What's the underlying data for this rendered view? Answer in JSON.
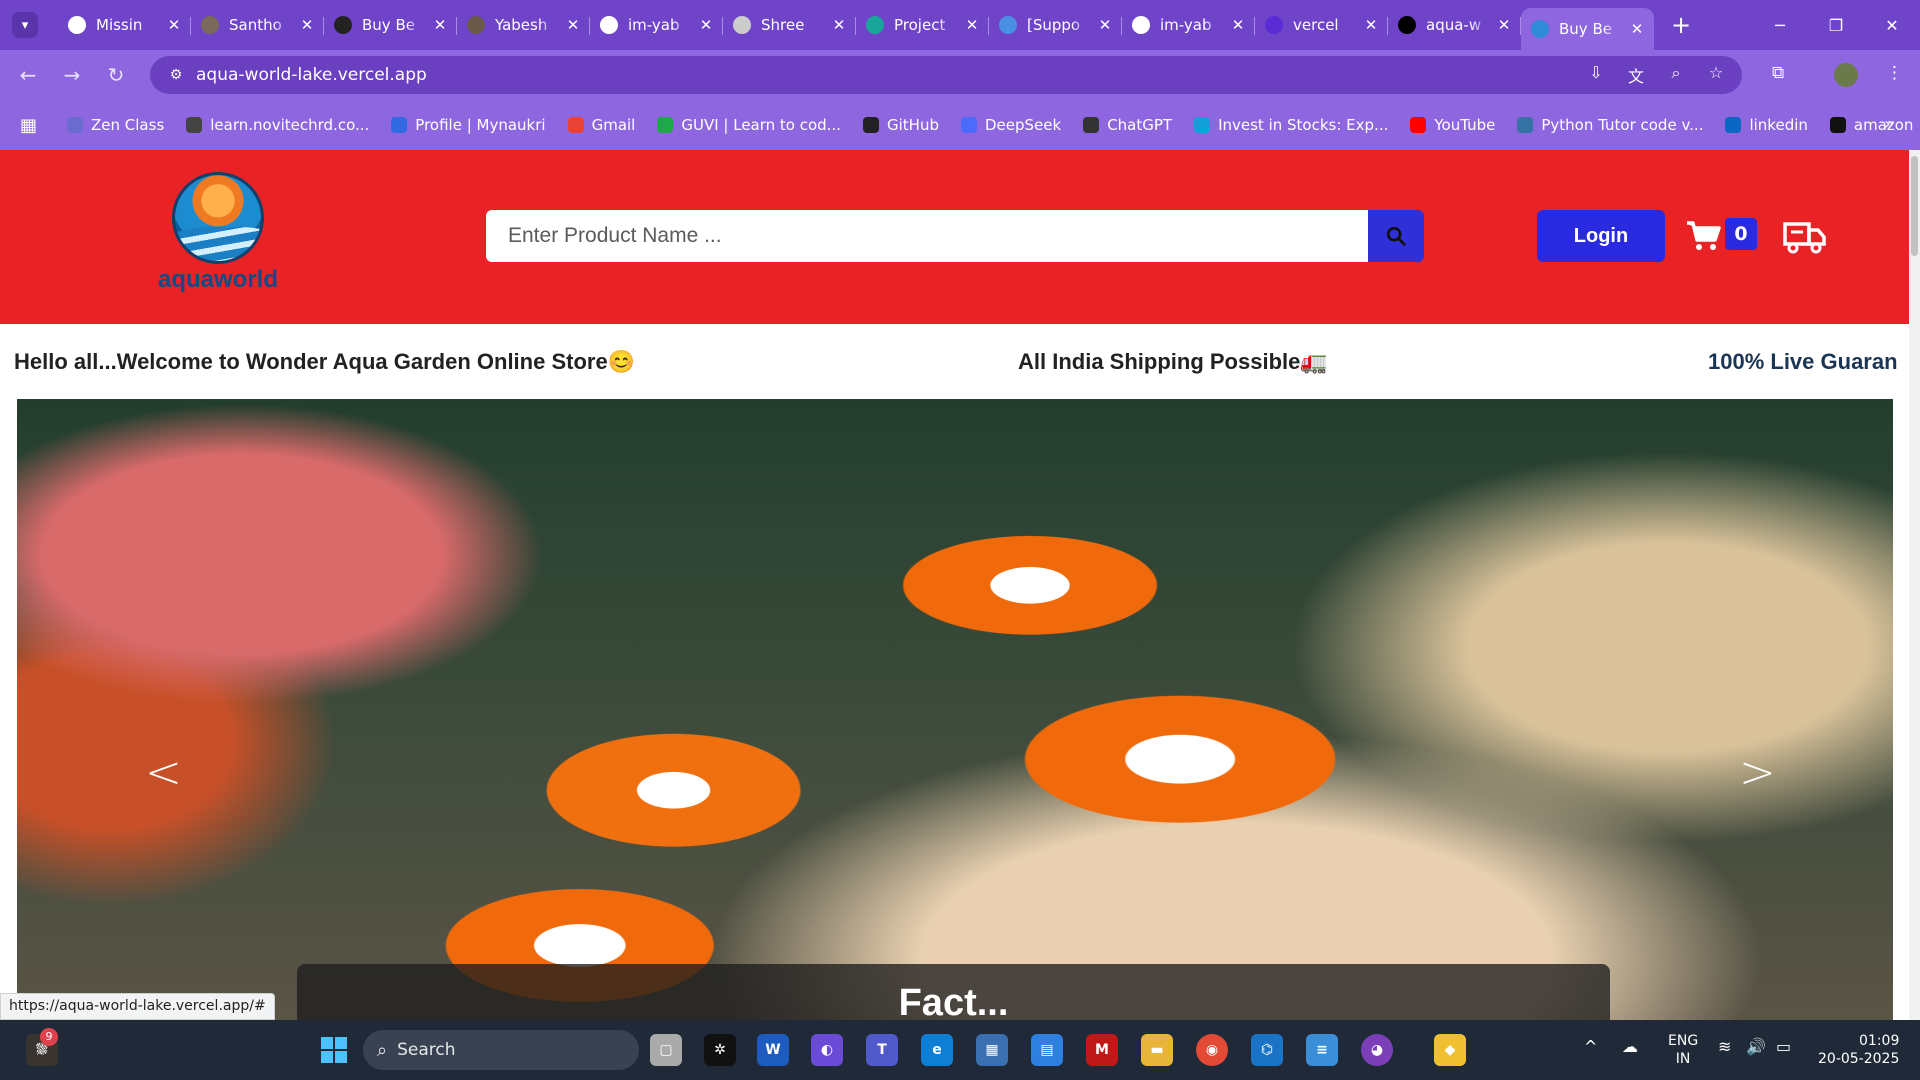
{
  "browser": {
    "tabs": [
      {
        "title": "Missin",
        "favicon_color": "#ffffff"
      },
      {
        "title": "Santho",
        "favicon_color": "#7a6a5a"
      },
      {
        "title": "Buy Be",
        "favicon_color": "#222222"
      },
      {
        "title": "Yabesh",
        "favicon_color": "#6a5a4a"
      },
      {
        "title": "im-yab",
        "favicon_color": "#ffffff"
      },
      {
        "title": "Shree",
        "favicon_color": "#cccccc"
      },
      {
        "title": "Project",
        "favicon_color": "#19a59a"
      },
      {
        "title": "[Suppo",
        "favicon_color": "#4a90e2"
      },
      {
        "title": "im-yab",
        "favicon_color": "#ffffff"
      },
      {
        "title": "vercel",
        "favicon_color": "#5b2bd6"
      },
      {
        "title": "aqua-w",
        "favicon_color": "#000000"
      },
      {
        "title": "Buy Be",
        "favicon_color": "#2f8ad8",
        "active": true
      }
    ],
    "url": "aqua-world-lake.vercel.app",
    "bookmarks": [
      {
        "label": "Zen Class",
        "color": "#6b6bd0"
      },
      {
        "label": "learn.novitechrd.co...",
        "color": "#444444"
      },
      {
        "label": "Profile | Mynaukri",
        "color": "#2f6ae0"
      },
      {
        "label": "Gmail",
        "color": "#ea4335"
      },
      {
        "label": "GUVI | Learn to cod...",
        "color": "#1fa84a"
      },
      {
        "label": "GitHub",
        "color": "#222222"
      },
      {
        "label": "DeepSeek",
        "color": "#4b6bfb"
      },
      {
        "label": "ChatGPT",
        "color": "#333333"
      },
      {
        "label": "Invest in Stocks: Exp...",
        "color": "#12a0d8"
      },
      {
        "label": "YouTube",
        "color": "#ff0000"
      },
      {
        "label": "Python Tutor code v...",
        "color": "#3572a5"
      },
      {
        "label": "linkedin",
        "color": "#0a66c2"
      },
      {
        "label": "amazon",
        "color": "#111111"
      }
    ],
    "status_url": "https://aqua-world-lake.vercel.app/#"
  },
  "site": {
    "logo_text": "aquaworld",
    "search_placeholder": "Enter Product Name ...",
    "login_label": "Login",
    "cart_count": "0",
    "ticker": [
      "Hello all...Welcome to Wonder Aqua Garden Online Store😊",
      "All India Shipping Possible🚛",
      "100% Live Guaran"
    ],
    "carousel_caption": "Fact..."
  },
  "taskbar": {
    "notification_count": "9",
    "search_label": "Search",
    "language_top": "ENG",
    "language_bottom": "IN",
    "time": "01:09",
    "date": "20-05-2025"
  },
  "colors": {
    "header_red": "#e92226",
    "accent_blue": "#2a2ae0",
    "browser_purple": "#8e67e0"
  }
}
